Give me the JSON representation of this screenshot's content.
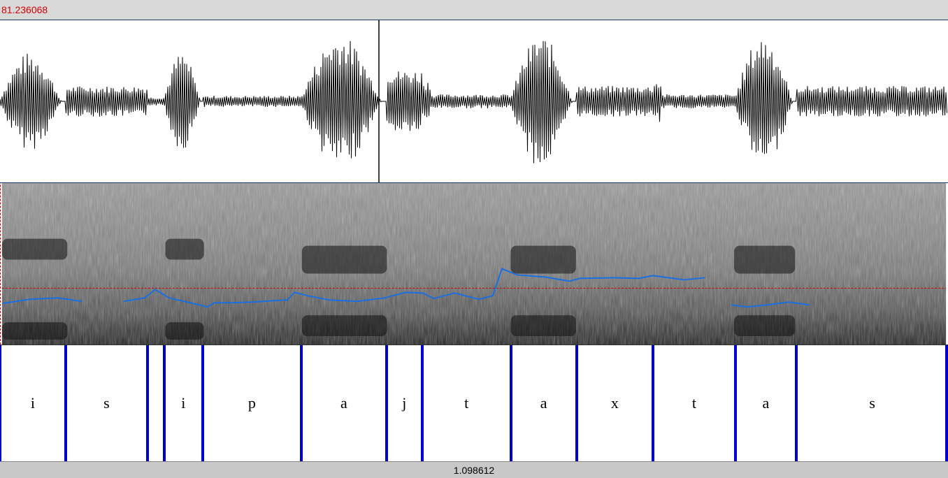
{
  "header": {
    "cursor_time": "81.236068"
  },
  "footer": {
    "selection_duration": "1.098612"
  },
  "tier": {
    "segments": [
      {
        "label": "i",
        "start": 0.0,
        "end": 0.076
      },
      {
        "label": "s",
        "start": 0.076,
        "end": 0.171
      },
      {
        "label": "",
        "start": 0.171,
        "end": 0.19
      },
      {
        "label": "i",
        "start": 0.19,
        "end": 0.235
      },
      {
        "label": "p",
        "start": 0.235,
        "end": 0.349
      },
      {
        "label": "a",
        "start": 0.349,
        "end": 0.448
      },
      {
        "label": "j",
        "start": 0.448,
        "end": 0.489
      },
      {
        "label": "t",
        "start": 0.489,
        "end": 0.592
      },
      {
        "label": "a",
        "start": 0.592,
        "end": 0.668
      },
      {
        "label": "x",
        "start": 0.668,
        "end": 0.757
      },
      {
        "label": "t",
        "start": 0.757,
        "end": 0.852
      },
      {
        "label": "a",
        "start": 0.852,
        "end": 0.923
      },
      {
        "label": "s",
        "start": 0.923,
        "end": 1.098612
      }
    ]
  },
  "colors": {
    "boundary": "#0000cc",
    "pitch": "#1a6fe0",
    "cursor": "#d00000"
  }
}
